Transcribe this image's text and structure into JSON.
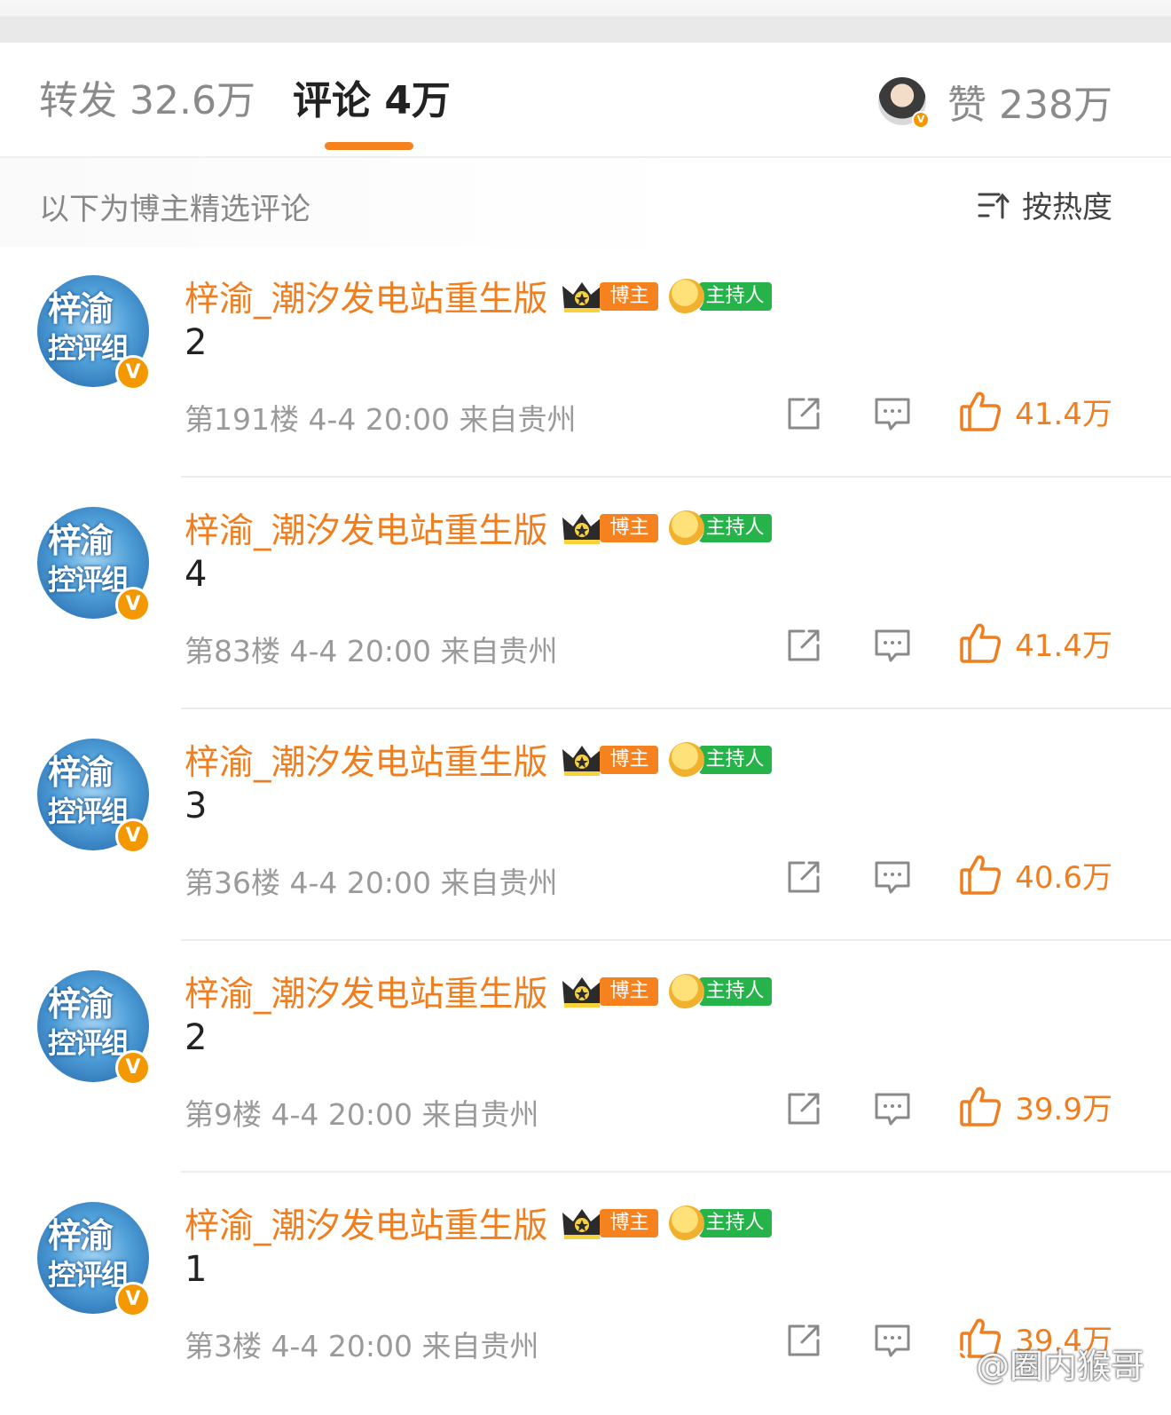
{
  "tabs": {
    "repost": "转发 32.6万",
    "comment": "评论 4万",
    "like": "赞 238万"
  },
  "subheader": {
    "note": "以下为博主精选评论",
    "sort_label": "按热度"
  },
  "avatar_text": {
    "line1": "梓渝",
    "line2": "控评组"
  },
  "badges": {
    "verified": "V",
    "blogger": "博主",
    "host": "主持人"
  },
  "comments": [
    {
      "username": "梓渝_潮汐发电站重生版",
      "text": "2",
      "meta": "第191楼 4-4 20:00 来自贵州",
      "likes": "41.4万"
    },
    {
      "username": "梓渝_潮汐发电站重生版",
      "text": "4",
      "meta": "第83楼 4-4 20:00 来自贵州",
      "likes": "41.4万"
    },
    {
      "username": "梓渝_潮汐发电站重生版",
      "text": "3",
      "meta": "第36楼 4-4 20:00 来自贵州",
      "likes": "40.6万"
    },
    {
      "username": "梓渝_潮汐发电站重生版",
      "text": "2",
      "meta": "第9楼 4-4 20:00 来自贵州",
      "likes": "39.9万"
    },
    {
      "username": "梓渝_潮汐发电站重生版",
      "text": "1",
      "meta": "第3楼 4-4 20:00 来自贵州",
      "likes": "39.4万"
    }
  ],
  "watermark": "@圈内猴哥",
  "colors": {
    "accent": "#f5821f",
    "host_green": "#25b34a",
    "username": "#f07e1e"
  }
}
